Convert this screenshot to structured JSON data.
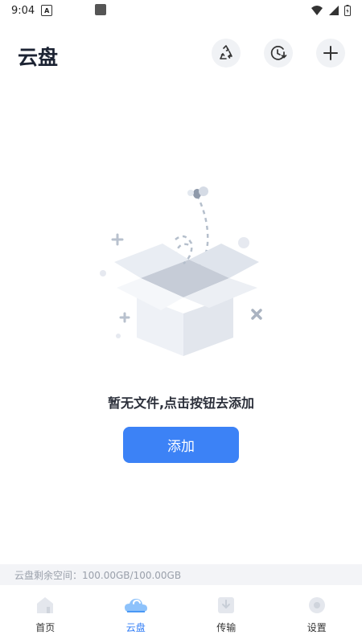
{
  "status": {
    "time": "9:04",
    "a_icon": "A"
  },
  "header": {
    "title": "云盘"
  },
  "header_icons": [
    "recycle-icon",
    "history-icon",
    "plus-icon"
  ],
  "empty": {
    "message": "暂无文件,点击按钮去添加",
    "button_label": "添加"
  },
  "storage": {
    "text": "云盘剩余空间：100.00GB/100.00GB"
  },
  "tabs": [
    {
      "label": "首页",
      "icon": "home-icon",
      "active": false
    },
    {
      "label": "云盘",
      "icon": "cloud-icon",
      "active": true
    },
    {
      "label": "传输",
      "icon": "transfer-icon",
      "active": false
    },
    {
      "label": "设置",
      "icon": "settings-icon",
      "active": false
    }
  ],
  "colors": {
    "accent": "#3c82f6",
    "title": "#1c2333",
    "tab_active": "#2f7cf6"
  }
}
